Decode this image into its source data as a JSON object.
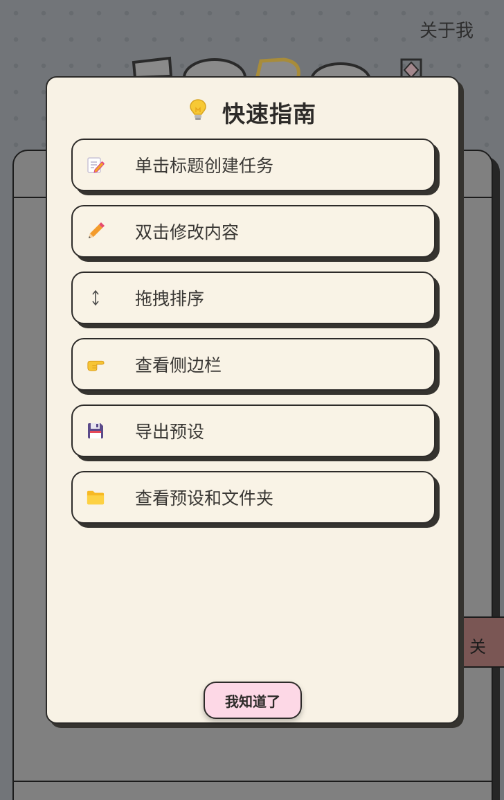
{
  "header": {
    "about_label": "关于我"
  },
  "side_tab": {
    "label": "关"
  },
  "guide": {
    "title": "快速指南",
    "title_icon": "lightbulb-icon",
    "items": [
      {
        "icon": "memo-icon",
        "label": "单击标题创建任务"
      },
      {
        "icon": "pencil-icon",
        "label": "双击修改内容"
      },
      {
        "icon": "up-down-arrow-icon",
        "label": "拖拽排序"
      },
      {
        "icon": "pointing-hand-icon",
        "label": "查看侧边栏"
      },
      {
        "icon": "floppy-disk-icon",
        "label": "导出预设"
      },
      {
        "icon": "folder-icon",
        "label": "查看预设和文件夹"
      }
    ],
    "confirm_label": "我知道了"
  },
  "colors": {
    "page_background": "#727579",
    "modal_background": "#f8f2e5",
    "confirm_button": "#fdd8e6",
    "side_tab": "#7a5654",
    "outline": "#2d2b29"
  }
}
